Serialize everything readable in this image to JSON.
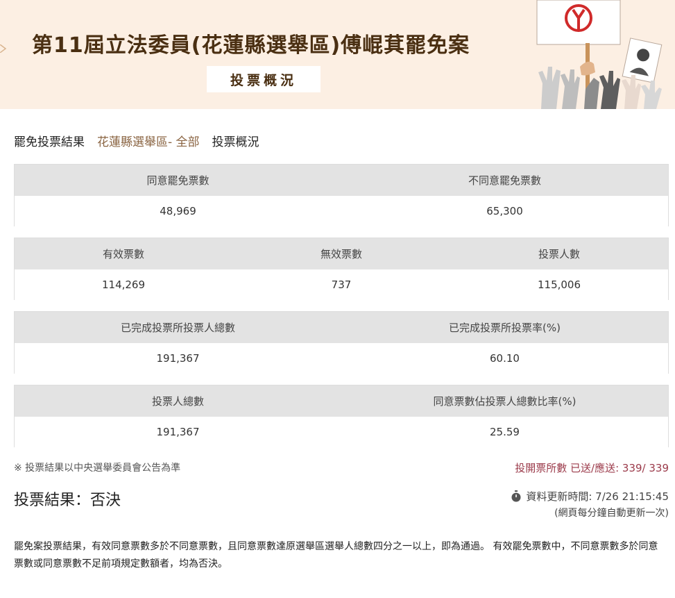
{
  "banner": {
    "title": "第11屆立法委員(花蓮縣選舉區)傅崐萁罷免案",
    "subtitle": "投票概況"
  },
  "breadcrumb": {
    "result": "罷免投票結果",
    "district": "花蓮縣選舉區- 全部",
    "overview": "投票概況"
  },
  "tables": {
    "votes": {
      "agree_label": "同意罷免票數",
      "agree_value": "48,969",
      "disagree_label": "不同意罷免票數",
      "disagree_value": "65,300"
    },
    "ballots": {
      "valid_label": "有效票數",
      "valid_value": "114,269",
      "invalid_label": "無效票數",
      "invalid_value": "737",
      "voters_label": "投票人數",
      "voters_value": "115,006"
    },
    "completed": {
      "electorate_label": "已完成投票所投票人總數",
      "electorate_value": "191,367",
      "turnout_label": "已完成投票所投票率(%)",
      "turnout_value": "60.10"
    },
    "overall": {
      "total_label": "投票人總數",
      "total_value": "191,367",
      "ratio_label": "同意票數佔投票人總數比率(%)",
      "ratio_value": "25.59"
    }
  },
  "footer": {
    "note": "※ 投票結果以中央選舉委員會公告為準",
    "progress": "投開票所數 已送/應送: 339/ 339",
    "result": "投票結果：否決",
    "update_time": "資料更新時間: 7/26 21:15:45",
    "refresh_note": "(網頁每分鐘自動更新一次)",
    "rule": "罷免案投票結果，有效同意票數多於不同意票數，且同意票數達原選舉區選舉人總數四分之一以上，即為通過。 有效罷免票數中，不同意票數多於同意票數或同意票數不足前項規定數額者，均為否決。"
  },
  "colors": {
    "banner_bg": "#fcefe3",
    "title": "#4a2f12",
    "district": "#8a6442",
    "progress": "#9b3a4a",
    "table_head": "#e3e3e3"
  },
  "icons": {
    "clock": "stopwatch-icon",
    "sign": "ballot-stamp-icon"
  }
}
